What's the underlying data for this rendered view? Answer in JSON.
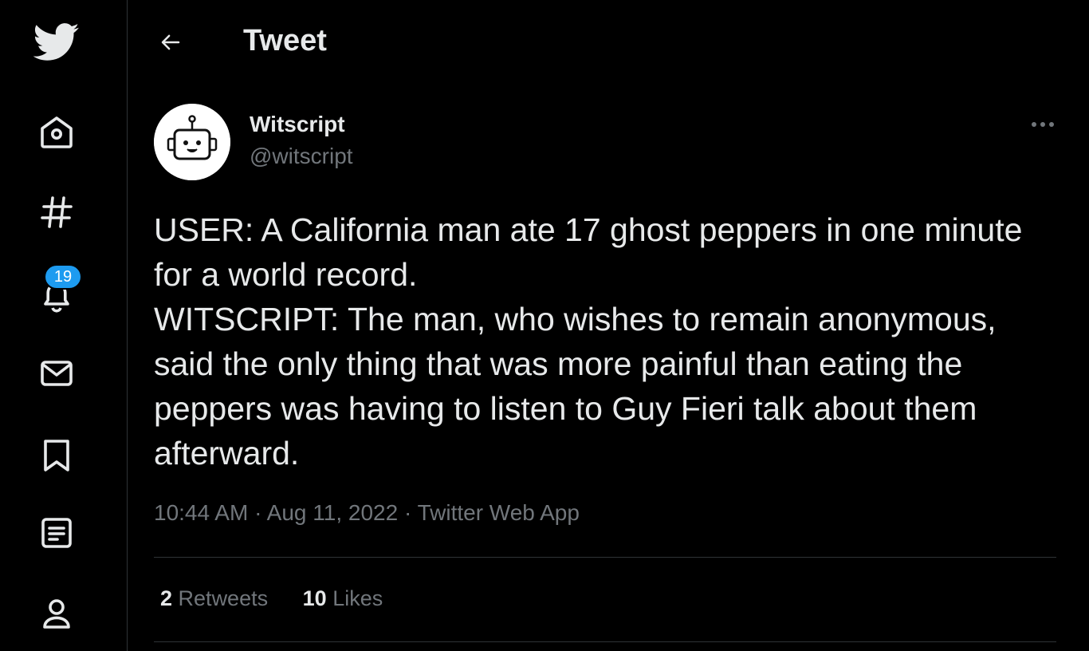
{
  "header": {
    "title": "Tweet"
  },
  "notifications": {
    "badge_count": "19"
  },
  "tweet": {
    "display_name": "Witscript",
    "handle": "@witscript",
    "text_lines": [
      "USER: A California man ate 17 ghost peppers in one minute for a world record.",
      "WITSCRIPT: The man, who wishes to remain anonymous, said the only thing that was more painful than eating the peppers was having to listen to Guy Fieri talk about them afterward."
    ],
    "time": "10:44 AM",
    "date": "Aug 11, 2022",
    "source": "Twitter Web App",
    "separator": "·",
    "retweets_count": "2",
    "retweets_label": "Retweets",
    "likes_count": "10",
    "likes_label": "Likes"
  },
  "icons": {
    "logo": "twitter-bird-icon",
    "home": "home-icon",
    "explore": "hashtag-icon",
    "notifications": "bell-icon",
    "messages": "envelope-icon",
    "bookmarks": "bookmark-icon",
    "lists": "list-icon",
    "profile": "person-icon",
    "back": "arrow-left-icon",
    "more": "more-horizontal-icon"
  },
  "colors": {
    "background": "#000000",
    "text_primary": "#e7e9ea",
    "text_secondary": "#71767b",
    "accent": "#1d9bf0",
    "divider": "#2f3336"
  }
}
